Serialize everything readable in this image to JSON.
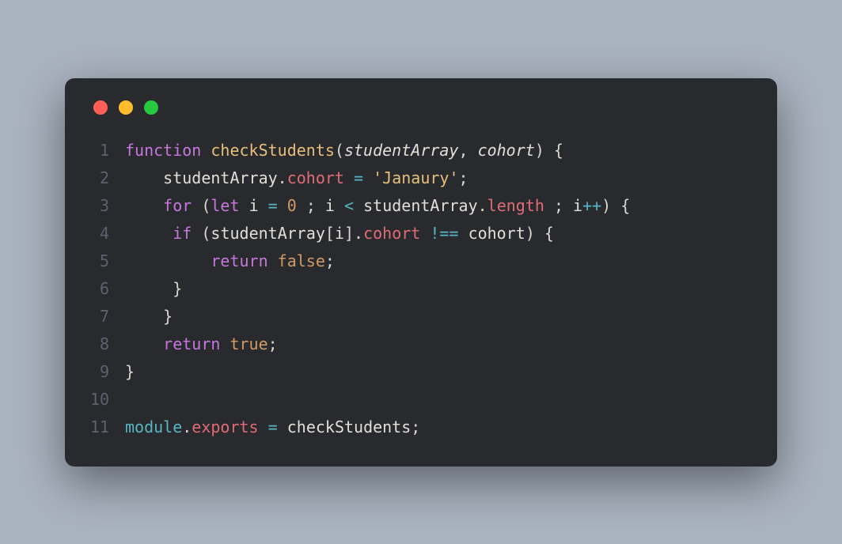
{
  "window": {
    "dots": [
      "red",
      "yellow",
      "green"
    ]
  },
  "code": {
    "lines": [
      {
        "num": "1",
        "tokens": [
          {
            "t": "function",
            "c": "tok-keyword"
          },
          {
            "t": " ",
            "c": ""
          },
          {
            "t": "checkStudents",
            "c": "tok-func"
          },
          {
            "t": "(",
            "c": "tok-punct"
          },
          {
            "t": "studentArray",
            "c": "tok-param"
          },
          {
            "t": ", ",
            "c": "tok-punct"
          },
          {
            "t": "cohort",
            "c": "tok-param"
          },
          {
            "t": ")",
            "c": "tok-punct"
          },
          {
            "t": " ",
            "c": ""
          },
          {
            "t": "{",
            "c": "tok-punct"
          }
        ]
      },
      {
        "num": "2",
        "tokens": [
          {
            "t": "    ",
            "c": ""
          },
          {
            "t": "studentArray",
            "c": "tok-ident"
          },
          {
            "t": ".",
            "c": "tok-punct"
          },
          {
            "t": "cohort",
            "c": "tok-prop"
          },
          {
            "t": " ",
            "c": ""
          },
          {
            "t": "=",
            "c": "tok-op"
          },
          {
            "t": " ",
            "c": ""
          },
          {
            "t": "'Janaury'",
            "c": "tok-string"
          },
          {
            "t": ";",
            "c": "tok-punct"
          }
        ]
      },
      {
        "num": "3",
        "tokens": [
          {
            "t": "    ",
            "c": ""
          },
          {
            "t": "for",
            "c": "tok-keyword"
          },
          {
            "t": " (",
            "c": "tok-punct"
          },
          {
            "t": "let",
            "c": "tok-keyword"
          },
          {
            "t": " ",
            "c": ""
          },
          {
            "t": "i",
            "c": "tok-ident"
          },
          {
            "t": " ",
            "c": ""
          },
          {
            "t": "=",
            "c": "tok-op"
          },
          {
            "t": " ",
            "c": ""
          },
          {
            "t": "0",
            "c": "tok-number"
          },
          {
            "t": " ; ",
            "c": "tok-punct"
          },
          {
            "t": "i",
            "c": "tok-ident"
          },
          {
            "t": " ",
            "c": ""
          },
          {
            "t": "<",
            "c": "tok-op"
          },
          {
            "t": " ",
            "c": ""
          },
          {
            "t": "studentArray",
            "c": "tok-ident"
          },
          {
            "t": ".",
            "c": "tok-punct"
          },
          {
            "t": "length",
            "c": "tok-prop"
          },
          {
            "t": " ; ",
            "c": "tok-punct"
          },
          {
            "t": "i",
            "c": "tok-ident"
          },
          {
            "t": "++",
            "c": "tok-op"
          },
          {
            "t": ") {",
            "c": "tok-punct"
          }
        ]
      },
      {
        "num": "4",
        "tokens": [
          {
            "t": "     ",
            "c": ""
          },
          {
            "t": "if",
            "c": "tok-keyword"
          },
          {
            "t": " (",
            "c": "tok-punct"
          },
          {
            "t": "studentArray",
            "c": "tok-ident"
          },
          {
            "t": "[",
            "c": "tok-punct"
          },
          {
            "t": "i",
            "c": "tok-ident"
          },
          {
            "t": "].",
            "c": "tok-punct"
          },
          {
            "t": "cohort",
            "c": "tok-prop"
          },
          {
            "t": " ",
            "c": ""
          },
          {
            "t": "!==",
            "c": "tok-op"
          },
          {
            "t": " ",
            "c": ""
          },
          {
            "t": "cohort",
            "c": "tok-ident"
          },
          {
            "t": ") {",
            "c": "tok-punct"
          }
        ]
      },
      {
        "num": "5",
        "tokens": [
          {
            "t": "         ",
            "c": ""
          },
          {
            "t": "return",
            "c": "tok-keyword"
          },
          {
            "t": " ",
            "c": ""
          },
          {
            "t": "false",
            "c": "tok-bool"
          },
          {
            "t": ";",
            "c": "tok-punct"
          }
        ]
      },
      {
        "num": "6",
        "tokens": [
          {
            "t": "     }",
            "c": "tok-punct"
          }
        ]
      },
      {
        "num": "7",
        "tokens": [
          {
            "t": "    }",
            "c": "tok-punct"
          }
        ]
      },
      {
        "num": "8",
        "tokens": [
          {
            "t": "    ",
            "c": ""
          },
          {
            "t": "return",
            "c": "tok-keyword"
          },
          {
            "t": " ",
            "c": ""
          },
          {
            "t": "true",
            "c": "tok-bool"
          },
          {
            "t": ";",
            "c": "tok-punct"
          }
        ]
      },
      {
        "num": "9",
        "tokens": [
          {
            "t": "}",
            "c": "tok-punct"
          }
        ]
      },
      {
        "num": "10",
        "tokens": []
      },
      {
        "num": "11",
        "tokens": [
          {
            "t": "module",
            "c": "tok-def"
          },
          {
            "t": ".",
            "c": "tok-punct"
          },
          {
            "t": "exports",
            "c": "tok-prop"
          },
          {
            "t": " ",
            "c": ""
          },
          {
            "t": "=",
            "c": "tok-op"
          },
          {
            "t": " ",
            "c": ""
          },
          {
            "t": "checkStudents",
            "c": "tok-ident"
          },
          {
            "t": ";",
            "c": "tok-punct"
          }
        ]
      }
    ]
  }
}
